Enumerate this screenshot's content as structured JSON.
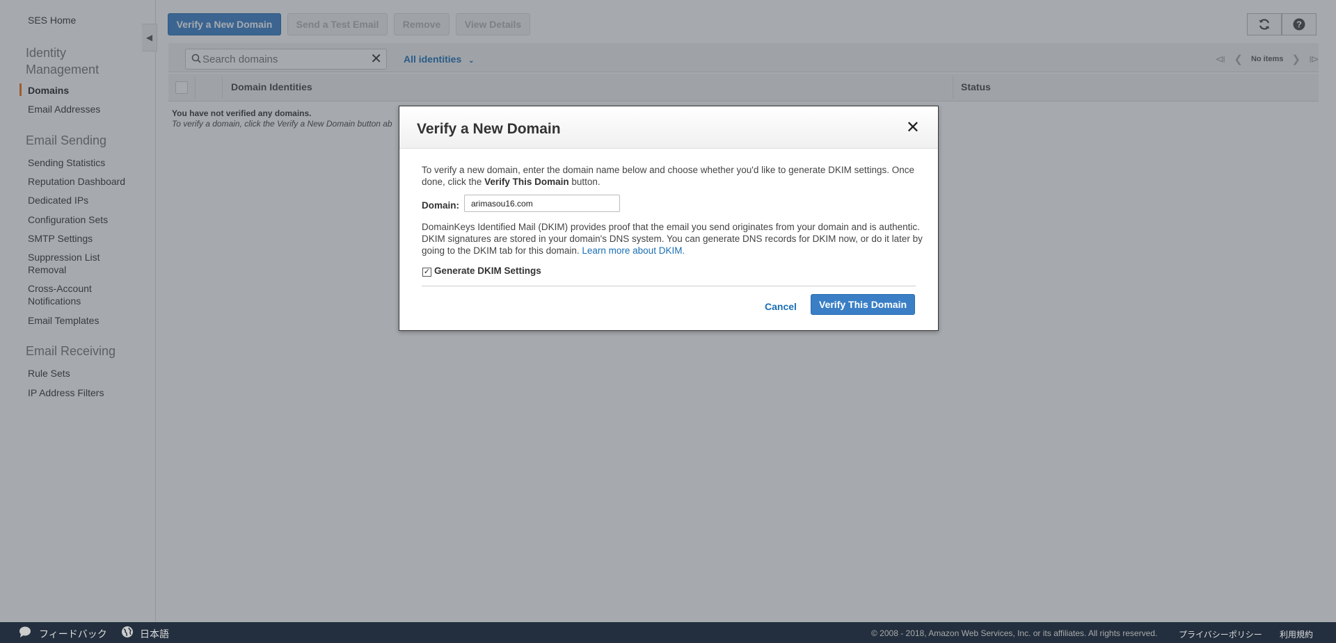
{
  "sidebar": {
    "home": "SES Home",
    "sections": [
      {
        "title": "Identity Management",
        "items": [
          "Domains",
          "Email Addresses"
        ]
      },
      {
        "title": "Email Sending",
        "items": [
          "Sending Statistics",
          "Reputation Dashboard",
          "Dedicated IPs",
          "Configuration Sets",
          "SMTP Settings",
          "Suppression List Removal",
          "Cross-Account Notifications",
          "Email Templates"
        ]
      },
      {
        "title": "Email Receiving",
        "items": [
          "Rule Sets",
          "IP Address Filters"
        ]
      }
    ],
    "active_item": "Domains"
  },
  "toolbar": {
    "verify_domain": "Verify a New Domain",
    "send_test": "Send a Test Email",
    "remove": "Remove",
    "view_details": "View Details"
  },
  "filter": {
    "search_placeholder": "Search domains",
    "identity_filter": "All identities"
  },
  "pager": {
    "status": "No items"
  },
  "table": {
    "columns": [
      "Domain Identities",
      "Status"
    ],
    "empty_title": "You have not verified any domains.",
    "empty_sub": "To verify a domain, click the Verify a New Domain button ab"
  },
  "modal": {
    "title": "Verify a New Domain",
    "intro_1": "To verify a new domain, enter the domain name below and choose whether you'd like to generate DKIM settings. Once done, click the ",
    "intro_bold": "Verify This Domain",
    "intro_2": " button.",
    "domain_label": "Domain:",
    "domain_value": "arimasou16.com",
    "dkim_text": "DomainKeys Identified Mail (DKIM) provides proof that the email you send originates from your domain and is authentic. DKIM signatures are stored in your domain's DNS system. You can generate DNS records for DKIM now, or do it later by going to the DKIM tab for this domain. ",
    "dkim_link": "Learn more about DKIM.",
    "dkim_checkbox": "Generate DKIM Settings",
    "dkim_checked": true,
    "cancel": "Cancel",
    "verify": "Verify This Domain"
  },
  "footer": {
    "feedback": "フィードバック",
    "language": "日本語",
    "copyright": "© 2008 - 2018, Amazon Web Services, Inc. or its affiliates. All rights reserved.",
    "privacy": "プライバシーポリシー",
    "terms": "利用規約"
  },
  "colors": {
    "accent": "#3a7fc6",
    "active_marker": "#ec7211",
    "footer_bg": "#232f3e",
    "link": "#1a6eb3"
  }
}
